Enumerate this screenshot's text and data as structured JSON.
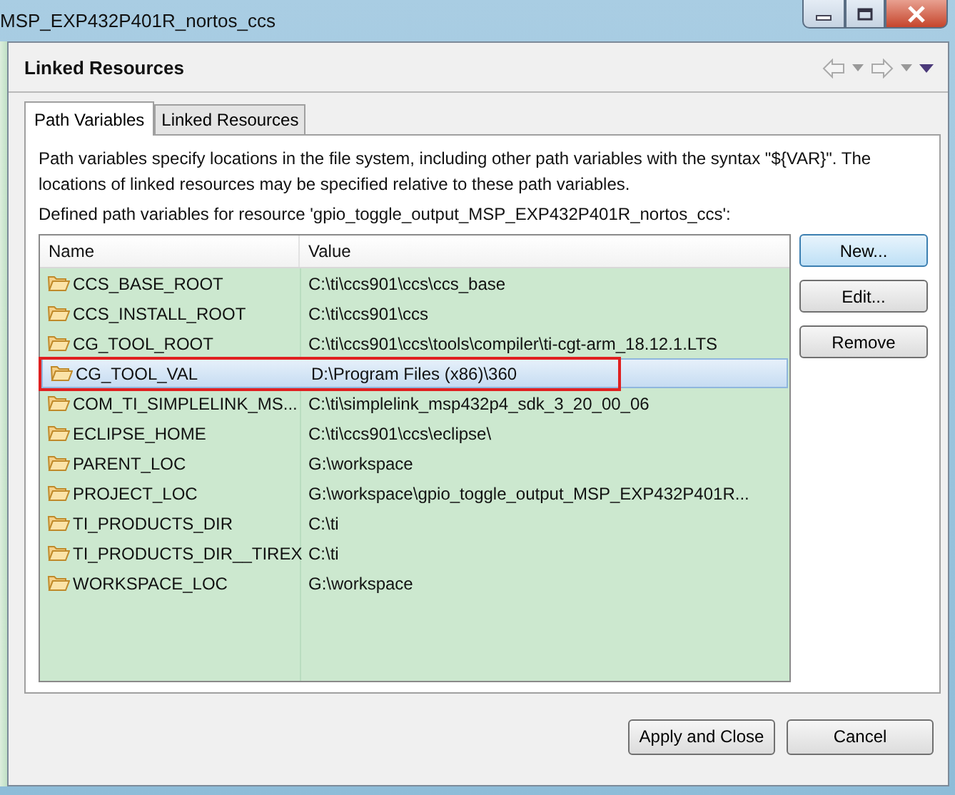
{
  "window": {
    "title": "MSP_EXP432P401R_nortos_ccs"
  },
  "page": {
    "title": "Linked Resources"
  },
  "tabs": [
    {
      "label": "Path Variables",
      "selected": true
    },
    {
      "label": "Linked Resources",
      "selected": false
    }
  ],
  "description": "Path variables specify locations in the file system, including other path variables with the syntax \"${VAR}\". The locations of linked resources may be specified relative to these path variables.",
  "table_caption": "Defined path variables for resource 'gpio_toggle_output_MSP_EXP432P401R_nortos_ccs':",
  "table": {
    "columns": [
      "Name",
      "Value"
    ],
    "rows": [
      {
        "name": "CCS_BASE_ROOT",
        "value": "C:\\ti\\ccs901\\ccs\\ccs_base",
        "selected": false,
        "annotated": false
      },
      {
        "name": "CCS_INSTALL_ROOT",
        "value": "C:\\ti\\ccs901\\ccs",
        "selected": false,
        "annotated": false
      },
      {
        "name": "CG_TOOL_ROOT",
        "value": "C:\\ti\\ccs901\\ccs\\tools\\compiler\\ti-cgt-arm_18.12.1.LTS",
        "selected": false,
        "annotated": false
      },
      {
        "name": "CG_TOOL_VAL",
        "value": "D:\\Program Files (x86)\\360",
        "selected": true,
        "annotated": true
      },
      {
        "name": "COM_TI_SIMPLELINK_MS...",
        "value": "C:\\ti\\simplelink_msp432p4_sdk_3_20_00_06",
        "selected": false,
        "annotated": false
      },
      {
        "name": "ECLIPSE_HOME",
        "value": "C:\\ti\\ccs901\\ccs\\eclipse\\",
        "selected": false,
        "annotated": false
      },
      {
        "name": "PARENT_LOC",
        "value": "G:\\workspace",
        "selected": false,
        "annotated": false
      },
      {
        "name": "PROJECT_LOC",
        "value": "G:\\workspace\\gpio_toggle_output_MSP_EXP432P401R...",
        "selected": false,
        "annotated": false
      },
      {
        "name": "TI_PRODUCTS_DIR",
        "value": "C:\\ti",
        "selected": false,
        "annotated": false
      },
      {
        "name": "TI_PRODUCTS_DIR__TIREX",
        "value": "C:\\ti",
        "selected": false,
        "annotated": false
      },
      {
        "name": "WORKSPACE_LOC",
        "value": "G:\\workspace",
        "selected": false,
        "annotated": false
      }
    ]
  },
  "side_buttons": [
    {
      "label": "New...",
      "default": true
    },
    {
      "label": "Edit...",
      "default": false
    },
    {
      "label": "Remove",
      "default": false
    }
  ],
  "footer_buttons": [
    "Apply and Close",
    "Cancel"
  ]
}
